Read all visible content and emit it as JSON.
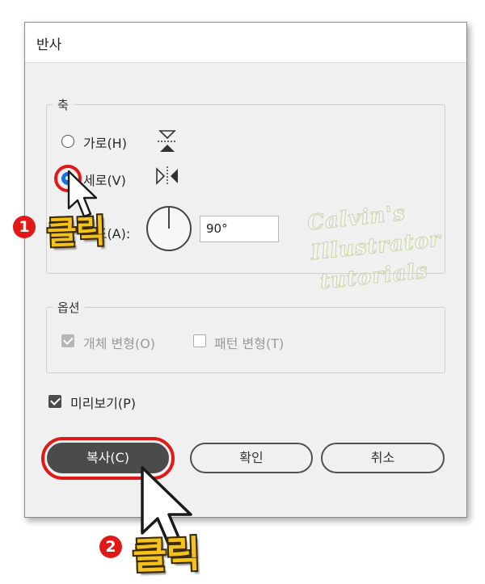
{
  "dialog": {
    "title": "반사"
  },
  "axis": {
    "group_label": "축",
    "horizontal_label": "가로(H)",
    "vertical_label": "세로(V)",
    "angle_label": "각도(A):",
    "angle_value": "90°",
    "selected": "vertical"
  },
  "options": {
    "group_label": "옵션",
    "transform_objects_label": "개체 변형(O)",
    "transform_objects_checked": true,
    "transform_patterns_label": "패턴 변형(T)",
    "transform_patterns_checked": false
  },
  "preview": {
    "label": "미리보기(P)",
    "checked": true
  },
  "buttons": {
    "copy": "복사(C)",
    "ok": "확인",
    "cancel": "취소"
  },
  "annotations": {
    "step1_number": "1",
    "step1_text": "클릭",
    "step2_number": "2",
    "step2_text": "클릭",
    "highlight_color": "#e01818",
    "label_color": "#f4c21b"
  },
  "watermark": {
    "line1": "Calvin's",
    "line2": "Illustrator",
    "line3": "tutorials"
  },
  "icons": {
    "horizontal_reflect": "reflect-horizontal-axis-icon",
    "vertical_reflect": "reflect-vertical-axis-icon",
    "angle_dial": "angle-dial-icon"
  }
}
